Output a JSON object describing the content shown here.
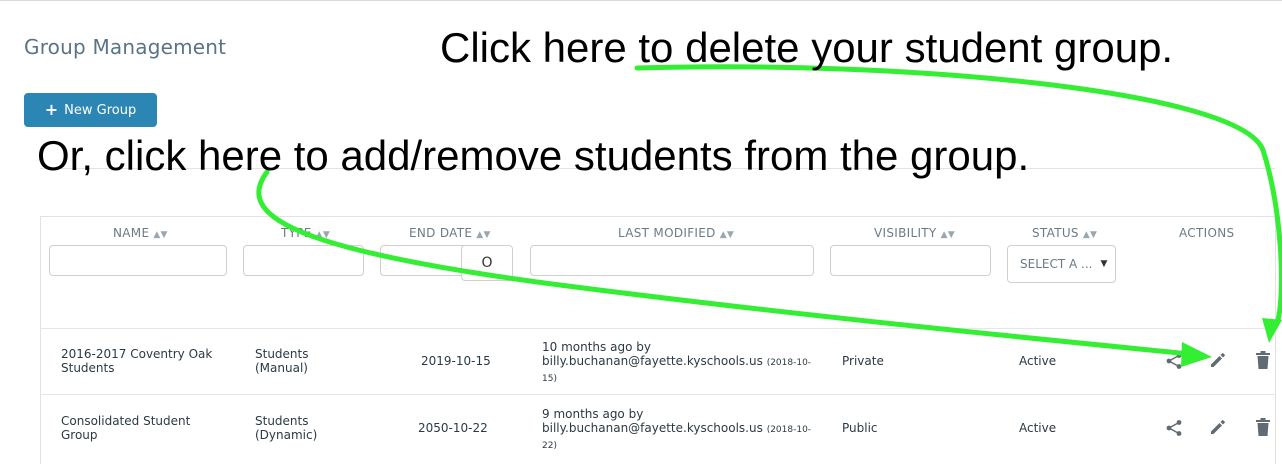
{
  "page": {
    "title": "Group Management",
    "new_group_label": "New Group",
    "new_group_icon": "plus-icon"
  },
  "callouts": {
    "delete": "Click here to delete your student group.",
    "add": "Or, click here to add/remove students from the group.",
    "arrow_color": "#33ee33"
  },
  "table": {
    "columns": [
      "NAME",
      "TYPE",
      "END DATE",
      "LAST MODIFIED",
      "VISIBILITY",
      "STATUS",
      "ACTIONS"
    ],
    "status_filter_placeholder": "SELECT A ...",
    "date_picker_glyph": "O",
    "rows": [
      {
        "name": [
          "2016-2017 Coventry Oak",
          "Students"
        ],
        "type": [
          "Students",
          "(Manual)"
        ],
        "end_date": "2019-10-15",
        "modified_line1": "10 months ago by",
        "modified_line2": "billy.buchanan@fayette.kyschools.us",
        "modified_date_a": "(2018-10-",
        "modified_date_b": "15)",
        "visibility": "Private",
        "status": "Active"
      },
      {
        "name": [
          "Consolidated Student",
          "Group"
        ],
        "type": [
          "Students",
          "(Dynamic)"
        ],
        "end_date": "2050-10-22",
        "modified_line1": "9 months ago by",
        "modified_line2": "billy.buchanan@fayette.kyschools.us",
        "modified_date_a": "(2018-10-",
        "modified_date_b": "22)",
        "visibility": "Public",
        "status": "Active"
      }
    ],
    "action_icons": [
      "share-icon",
      "pencil-icon",
      "trash-icon"
    ]
  }
}
